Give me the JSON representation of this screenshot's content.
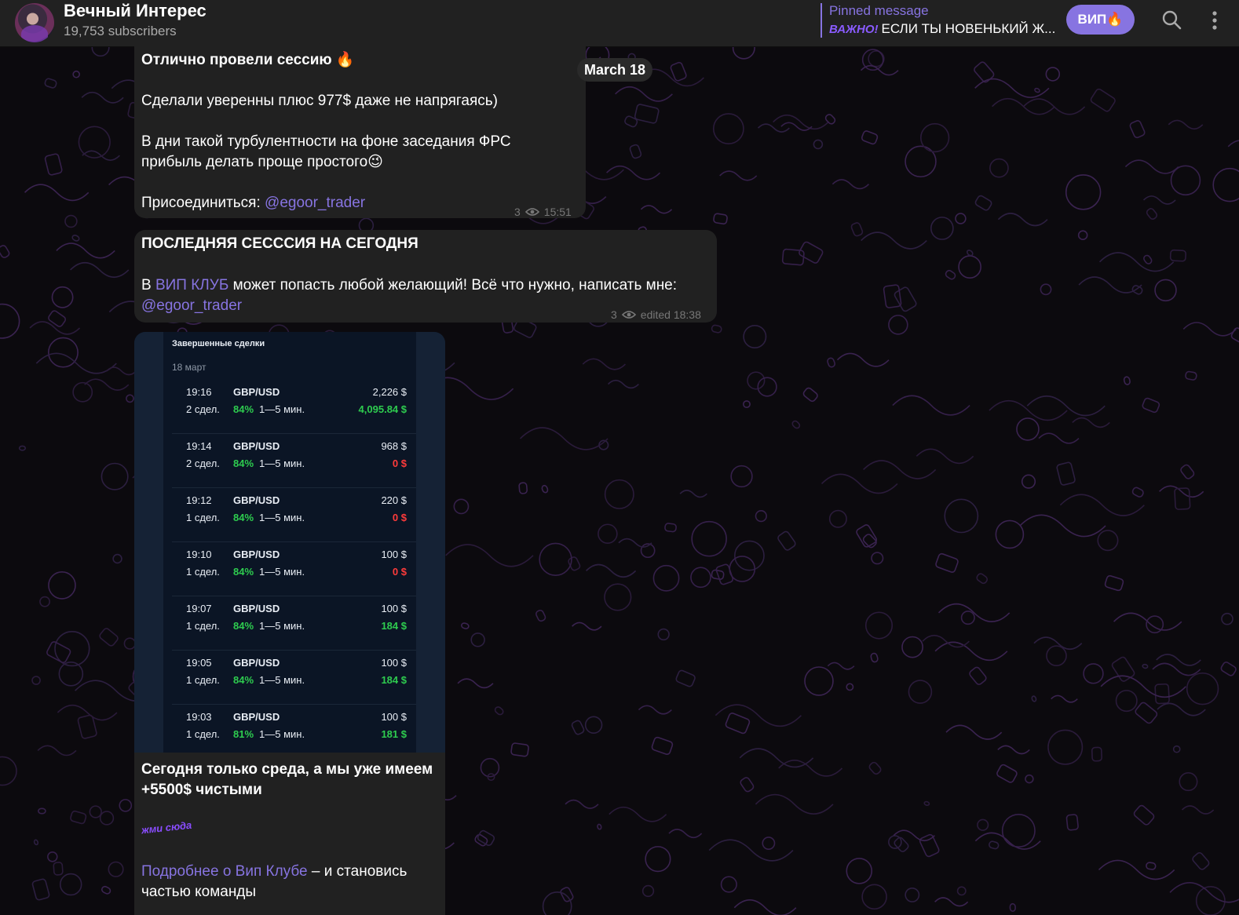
{
  "header": {
    "channel_title": "Вечный Интерес",
    "subscribers": "19,753 subscribers",
    "pinned_label": "Pinned message",
    "pinned_tag": "ВАЖНО!",
    "pinned_text": "ЕСЛИ ТЫ НОВЕНЬКИЙ Ж...",
    "vip_button": "ВИП🔥",
    "icons": [
      "search-icon",
      "more-vertical-icon"
    ]
  },
  "date_pill": "March 18",
  "message1": {
    "title": "Отлично провели сессию 🔥",
    "line1": "Сделали уверенны плюс 977$ даже не напрягаясь)",
    "line2a": "В дни такой турбулентности на фоне заседания ФРС",
    "line2b": "прибыль делать проще простого😉",
    "join_label": "Присоединиться: ",
    "join_link": "@egoor_trader",
    "views": "3",
    "time": "15:51"
  },
  "message2": {
    "title": "ПОСЛЕДНЯЯ СЕСССИЯ НА СЕГОДНЯ",
    "text_pre": "В ",
    "text_link": "ВИП КЛУБ",
    "text_post": " может попасть любой желающий! Всё что нужно, написать мне:",
    "contact_link": "@egoor_trader",
    "views": "3",
    "time": "edited 18:38"
  },
  "trades_screenshot": {
    "title": "Завершенные сделки",
    "date": "18 март",
    "rows": [
      {
        "time": "19:16",
        "pair": "GBP/USD",
        "amount": "2,226 $",
        "count": "2 сдел.",
        "pct": "84%",
        "duration": "1—5 мин.",
        "payout": "4,095.84 $",
        "status": "win"
      },
      {
        "time": "19:14",
        "pair": "GBP/USD",
        "amount": "968 $",
        "count": "2 сдел.",
        "pct": "84%",
        "duration": "1—5 мин.",
        "payout": "0 $",
        "status": "loss"
      },
      {
        "time": "19:12",
        "pair": "GBP/USD",
        "amount": "220 $",
        "count": "1 сдел.",
        "pct": "84%",
        "duration": "1—5 мин.",
        "payout": "0 $",
        "status": "loss"
      },
      {
        "time": "19:10",
        "pair": "GBP/USD",
        "amount": "100 $",
        "count": "1 сдел.",
        "pct": "84%",
        "duration": "1—5 мин.",
        "payout": "0 $",
        "status": "loss"
      },
      {
        "time": "19:07",
        "pair": "GBP/USD",
        "amount": "100 $",
        "count": "1 сдел.",
        "pct": "84%",
        "duration": "1—5 мин.",
        "payout": "184 $",
        "status": "win"
      },
      {
        "time": "19:05",
        "pair": "GBP/USD",
        "amount": "100 $",
        "count": "1 сдел.",
        "pct": "84%",
        "duration": "1—5 мин.",
        "payout": "184 $",
        "status": "win"
      },
      {
        "time": "19:03",
        "pair": "GBP/USD",
        "amount": "100 $",
        "count": "1 сдел.",
        "pct": "81%",
        "duration": "1—5 мин.",
        "payout": "181 $",
        "status": "win"
      }
    ]
  },
  "message3": {
    "line1": "Сегодня только среда, а мы уже имеем",
    "line2": "+5500$ чистыми",
    "sticker": "жми сюда",
    "link": "Подробнее о Вип Клубе",
    "after_link": " – и становись",
    "line_last": "частью команды"
  },
  "colors": {
    "accent": "#8774e1",
    "bubble": "#212121",
    "win": "#2ecc4f",
    "loss": "#ff3b3b"
  }
}
